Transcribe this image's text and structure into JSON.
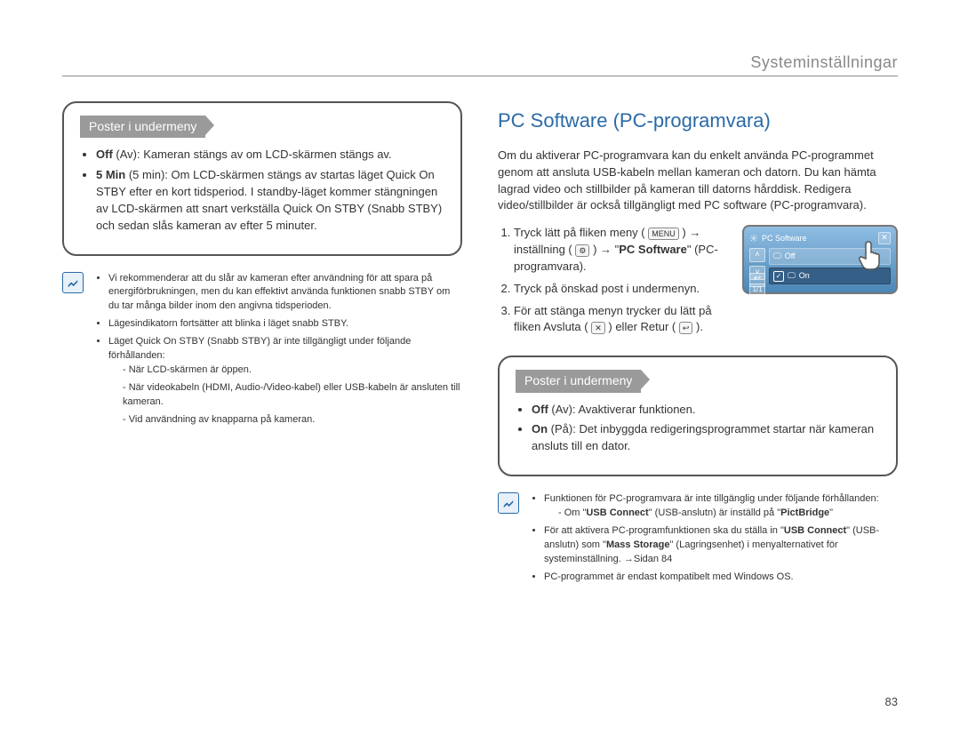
{
  "header": {
    "title": "Systeminställningar"
  },
  "page_number": "83",
  "left": {
    "submenu_box": {
      "title": "Poster i undermeny",
      "items": [
        "<b>Off</b> (Av): Kameran stängs av om LCD-skärmen stängs av.",
        "<b>5 Min</b> (5 min): Om LCD-skärmen stängs av startas läget Quick On STBY efter en kort tidsperiod. I standby-läget kommer stängningen av LCD-skärmen att snart verkställa Quick On STBY (Snabb STBY) och sedan slås kameran av efter 5 minuter."
      ]
    },
    "note": {
      "bullets": [
        "Vi rekommenderar att du slår av kameran efter användning för att spara på energiförbrukningen, men du kan effektivt använda funktionen snabb STBY om du tar många bilder inom den angivna tidsperioden.",
        "Lägesindikatorn fortsätter att blinka i läget snabb STBY.",
        "Läget Quick On STBY (Snabb STBY) är inte tillgängligt under följande förhållanden:"
      ],
      "sub_dashes": [
        "När LCD-skärmen är öppen.",
        "När videokabeln (HDMI, Audio-/Video-kabel) eller USB-kabeln är ansluten till kameran.",
        "Vid användning av knapparna på kameran."
      ]
    }
  },
  "right": {
    "title": "PC Software (PC-programvara)",
    "intro": "Om du aktiverar PC-programvara kan du enkelt använda PC-programmet genom att ansluta USB-kabeln mellan kameran och datorn. Du kan hämta lagrad video och stillbilder på kameran till datorns hårddisk. Redigera video/stillbilder är också tillgängligt med PC software (PC-programvara).",
    "steps": [
      {
        "pre": "Tryck lätt på fliken meny (",
        "mid": ") → inställning (",
        "mid2": ") → \"",
        "bold": "PC Software",
        "after": "\" (PC-programvara)."
      },
      {
        "text": "Tryck på önskad post i undermenyn."
      },
      {
        "pre": "För att stänga menyn trycker du lätt på fliken Avsluta (",
        "mid": ") eller Retur (",
        "after": ")."
      }
    ],
    "icons": {
      "menu": "MENU",
      "gear": "⚙",
      "close": "✕",
      "return": "↩"
    },
    "lcd": {
      "title": "PC Software",
      "option_off": "Off",
      "option_on": "On"
    },
    "submenu_box": {
      "title": "Poster i undermeny",
      "items": [
        "<b>Off</b> (Av): Avaktiverar funktionen.",
        "<b>On</b> (På): Det inbyggda redigeringsprogrammet startar när kameran ansluts till en dator."
      ]
    },
    "note": {
      "bullets": [
        "Funktionen för PC-programvara är inte tillgänglig under följande förhållanden:",
        "För att aktivera PC-programfunktionen ska du ställa in \"<b>USB Connect</b>\" (USB-anslutn) som \"<b>Mass Storage</b>\" (Lagringsenhet) i menyalternativet för systeminställning. →Sidan 84",
        "PC-programmet är endast kompatibelt med Windows OS."
      ],
      "sub_dashes": [
        "Om \"<b>USB Connect</b>\" (USB-anslutn) är inställd på \"<b>PictBridge</b>\""
      ]
    }
  }
}
